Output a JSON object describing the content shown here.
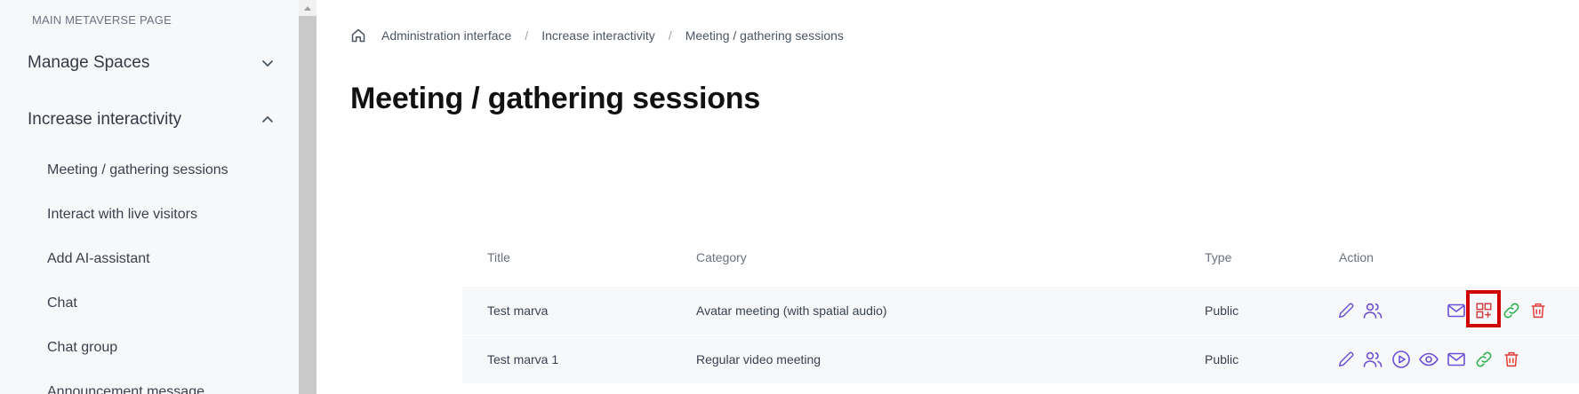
{
  "sidebar": {
    "header": "MAIN METAVERSE PAGE",
    "groups": [
      {
        "label": "Manage Spaces",
        "icon": "chevron-down-icon"
      },
      {
        "label": "Increase interactivity",
        "icon": "chevron-up-icon"
      }
    ],
    "items": [
      {
        "label": "Meeting / gathering sessions"
      },
      {
        "label": "Interact with live visitors"
      },
      {
        "label": "Add AI-assistant"
      },
      {
        "label": "Chat"
      },
      {
        "label": "Chat group"
      },
      {
        "label": "Announcement message"
      }
    ]
  },
  "breadcrumb": {
    "home_icon": "home-icon",
    "items": [
      "Administration interface",
      "Increase interactivity",
      "Meeting / gathering sessions"
    ],
    "separator": "/"
  },
  "page": {
    "title": "Meeting / gathering sessions"
  },
  "table": {
    "headers": {
      "title": "Title",
      "category": "Category",
      "type": "Type",
      "action": "Action"
    },
    "rows": [
      {
        "title": "Test marva",
        "category": "Avatar meeting (with spatial audio)",
        "type": "Public",
        "actions": [
          "edit-icon",
          "users-icon",
          "mail-icon",
          "qr-add-icon",
          "link-icon",
          "delete-icon"
        ]
      },
      {
        "title": "Test marva 1",
        "category": "Regular video meeting",
        "type": "Public",
        "actions": [
          "edit-icon",
          "users-icon",
          "play-icon",
          "view-icon",
          "mail-icon",
          "link-icon",
          "delete-icon"
        ]
      }
    ]
  },
  "colors": {
    "accent": "#6d4fd6",
    "link": "#2bb24c",
    "danger": "#e53935",
    "highlight": "#d00000"
  }
}
